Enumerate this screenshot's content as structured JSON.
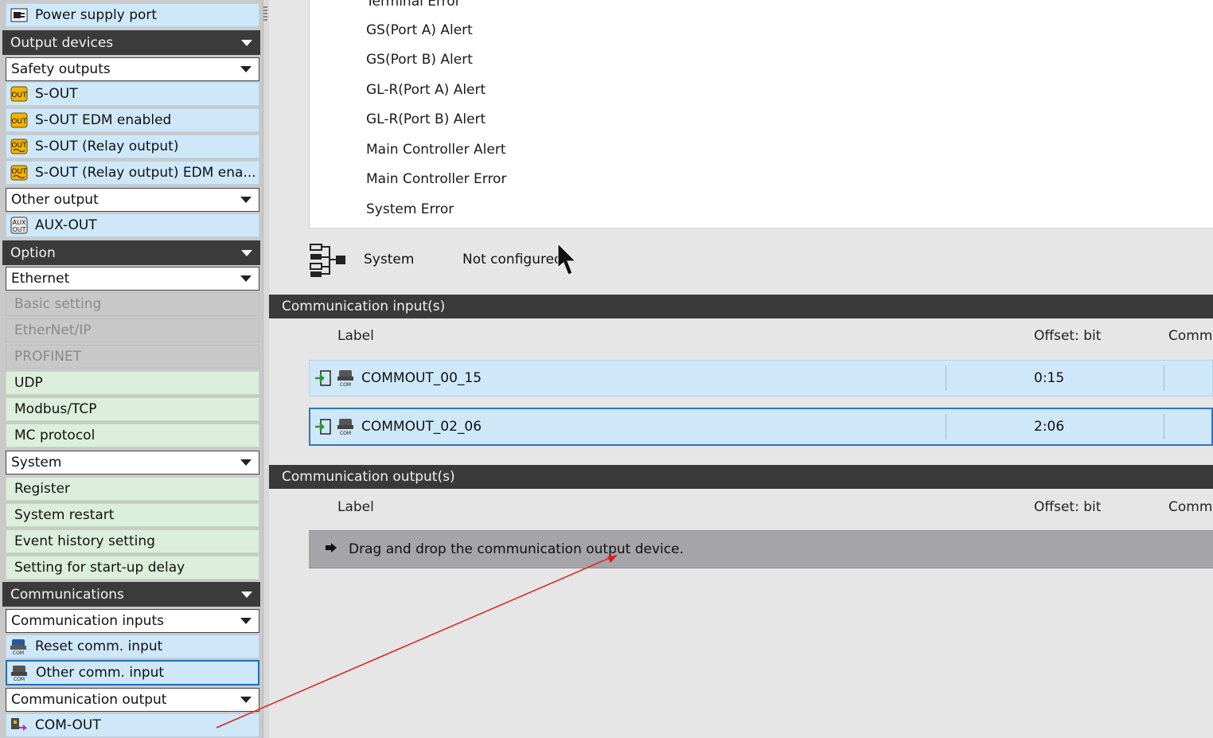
{
  "palette": {
    "power_supply_port": "Power supply port",
    "output_devices": "Output devices",
    "safety_outputs": "Safety outputs",
    "sout": "S-OUT",
    "sout_edm": "S-OUT EDM enabled",
    "sout_relay": "S-OUT (Relay output)",
    "sout_relay_edm": "S-OUT (Relay output) EDM ena...",
    "other_output": "Other output",
    "aux_out": "AUX-OUT",
    "option": "Option",
    "ethernet": "Ethernet",
    "basic_setting": "Basic setting",
    "ethernet_ip": "EtherNet/IP",
    "profinet": "PROFINET",
    "udp": "UDP",
    "modbus": "Modbus/TCP",
    "mc_protocol": "MC protocol",
    "system": "System",
    "register": "Register",
    "system_restart": "System restart",
    "event_history": "Event history setting",
    "startup_delay": "Setting for start-up delay",
    "communications": "Communications",
    "comm_inputs": "Communication inputs",
    "reset_comm": "Reset comm. input",
    "other_comm": "Other comm. input",
    "comm_output": "Communication output",
    "com_out": "COM-OUT"
  },
  "alerts": [
    "Terminal Error",
    "GS(Port A) Alert",
    "GS(Port B) Alert",
    "GL-R(Port A) Alert",
    "GL-R(Port B) Alert",
    "Main Controller Alert",
    "Main Controller Error",
    "System Error"
  ],
  "system_row": {
    "label": "System",
    "status": "Not configured"
  },
  "comm_inputs": {
    "title": "Communication input(s)",
    "col_label": "Label",
    "col_offset": "Offset: bit",
    "col_comment": "Comme",
    "rows": [
      {
        "label": "COMMOUT_00_15",
        "offset": "0:15"
      },
      {
        "label": "COMMOUT_02_06",
        "offset": "2:06"
      }
    ]
  },
  "comm_outputs": {
    "title": "Communication output(s)",
    "col_label": "Label",
    "col_offset": "Offset: bit",
    "col_comment": "Comme",
    "drop_hint": "Drag and drop the communication output device."
  },
  "icons": {
    "out_badge": "OUT",
    "aux_badge_top": "AUX",
    "aux_badge_bottom": "OUT",
    "com_badge": "COM"
  }
}
